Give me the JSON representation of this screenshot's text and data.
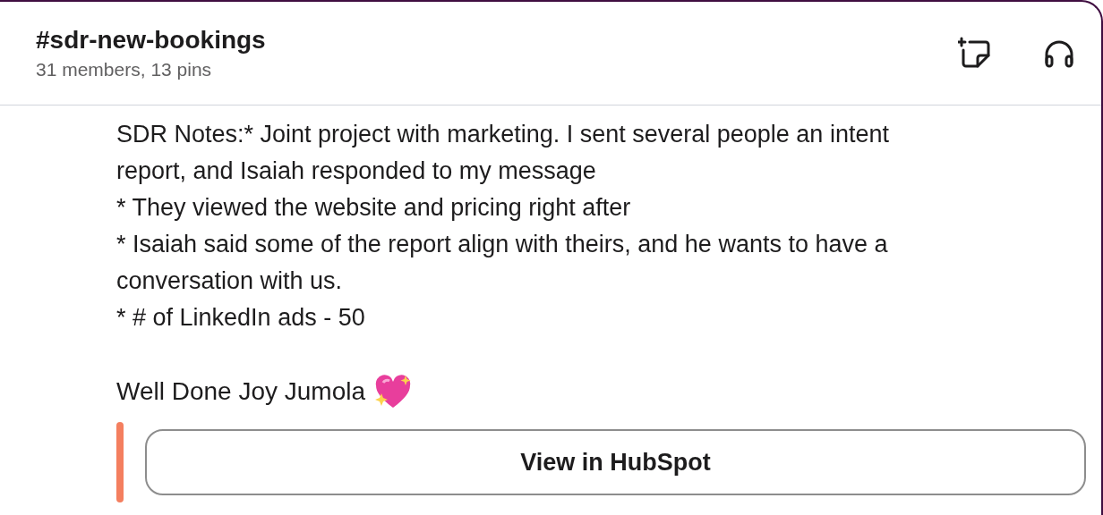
{
  "channel": {
    "name": "#sdr-new-bookings",
    "details": "31 members, 13 pins"
  },
  "message": {
    "lines": [
      "SDR Notes:* Joint project with marketing. I sent several people an intent",
      "report, and Isaiah responded to my message",
      "* They viewed the website and pricing right after",
      "* Isaiah said some of the report align with theirs, and he wants to have a",
      "conversation with us.",
      "* # of LinkedIn ads - 50"
    ],
    "closing": "Well Done Joy Jumola",
    "attachment": {
      "color": "#f47f5f",
      "button": "View in HubSpot"
    }
  }
}
